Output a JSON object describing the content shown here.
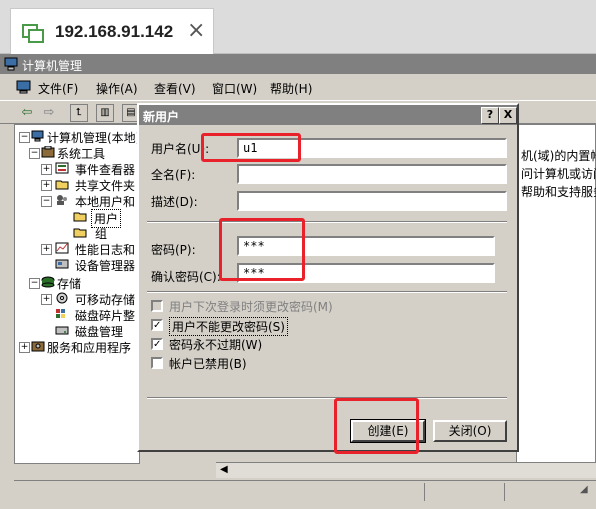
{
  "remote_tab": {
    "host": "192.168.91.142",
    "close": "×"
  },
  "window": {
    "title": "计算机管理"
  },
  "menu": [
    "文件(F)",
    "操作(A)",
    "查看(V)",
    "窗口(W)",
    "帮助(H)"
  ],
  "tree": {
    "root": "计算机管理(本地)",
    "system_tools": "系统工具",
    "event_viewer": "事件查看器",
    "shared_folders": "共享文件夹",
    "local_users": "本地用户和",
    "users": "用户",
    "groups": "组",
    "perf_logs": "性能日志和",
    "device_manager": "设备管理器",
    "storage": "存储",
    "removable": "可移动存储",
    "defrag": "磁盘碎片整",
    "disk_mgmt": "磁盘管理",
    "services": "服务和应用程序"
  },
  "right_pane": [
    "机(域)的内置帐",
    "问计算机或访问",
    "帮助和支持服务"
  ],
  "dialog": {
    "title": "新用户",
    "help_btn": "?",
    "close_btn": "X",
    "username_label": "用户名(U):",
    "username_value": "u1",
    "fullname_label": "全名(F):",
    "fullname_value": "",
    "desc_label": "描述(D):",
    "desc_value": "",
    "password_label": "密码(P):",
    "password_value": "***",
    "confirm_label": "确认密码(C):",
    "confirm_value": "***",
    "cb_must_change": "用户下次登录时须更改密码(M)",
    "cb_cannot_change": "用户不能更改密码(S)",
    "cb_never_expires": "密码永不过期(W)",
    "cb_disabled": "帐户已禁用(B)",
    "create_btn": "创建(E)",
    "close_btn_label": "关闭(O)"
  },
  "checkboxes": {
    "must_change": false,
    "cannot_change": true,
    "never_expires": true,
    "disabled": false
  },
  "colors": {
    "highlight": "#e8212b",
    "titlebar": "#808080",
    "face": "#d4d0c8"
  }
}
